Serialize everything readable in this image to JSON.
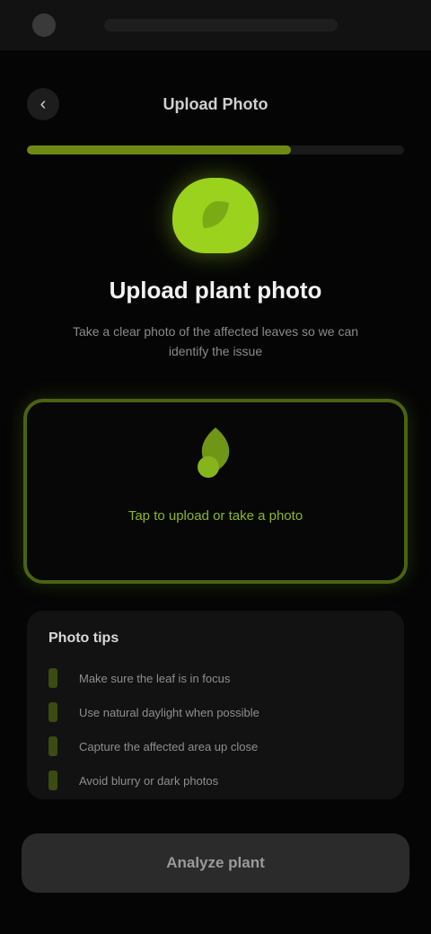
{
  "status_bar": {
    "title": ""
  },
  "nav": {
    "back_icon": "back-arrow-icon",
    "title": "Upload Photo",
    "progress_fraction": 0.7
  },
  "hero": {
    "icon": "plant-leaf-icon",
    "title": "Upload plant photo",
    "subtitle": "Take a clear photo of the affected leaves so we can identify the issue"
  },
  "upload": {
    "icon": "upload-leaf-icon",
    "label": "Tap to upload or take a photo"
  },
  "tips": {
    "title": "Photo tips",
    "items": [
      "Make sure the leaf is in focus",
      "Use natural daylight when possible",
      "Capture the affected area up close",
      "Avoid blurry or dark photos"
    ]
  },
  "cta": {
    "label": "Analyze plant"
  },
  "colors": {
    "accent": "#9bd21d",
    "accent_dim": "#4a6310",
    "background": "#050505",
    "card": "#121212"
  }
}
